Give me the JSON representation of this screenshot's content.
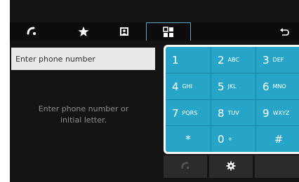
{
  "tabs": [
    {
      "name": "recent-calls",
      "icon": "handset-icon"
    },
    {
      "name": "favorites",
      "icon": "star-icon"
    },
    {
      "name": "contacts",
      "icon": "contacts-book-icon"
    },
    {
      "name": "keypad",
      "icon": "keypad-grid-icon",
      "active": true
    }
  ],
  "back_icon": "back-arrow-icon",
  "search": {
    "placeholder": "Enter phone number",
    "value": ""
  },
  "hint": {
    "line1": "Enter phone number or",
    "line2": "initial letter."
  },
  "keypad": {
    "keys": [
      {
        "digit": "1",
        "letters": ""
      },
      {
        "digit": "2",
        "letters": "ABC"
      },
      {
        "digit": "3",
        "letters": "DEF"
      },
      {
        "digit": "4",
        "letters": "GHI"
      },
      {
        "digit": "5",
        "letters": "JKL"
      },
      {
        "digit": "6",
        "letters": "MNO"
      },
      {
        "digit": "7",
        "letters": "PQRS"
      },
      {
        "digit": "8",
        "letters": "TUV"
      },
      {
        "digit": "9",
        "letters": "WXYZ"
      },
      {
        "digit": "*",
        "letters": ""
      },
      {
        "digit": "0",
        "letters": "+"
      },
      {
        "digit": "#",
        "letters": ""
      }
    ]
  },
  "bottom": {
    "call_icon": "call-handset-icon",
    "settings_icon": "gear-icon"
  },
  "colors": {
    "keypad": "#27a5c9",
    "background": "#141414",
    "input": "#e9e9e9",
    "hint": "#8c8c8c"
  }
}
